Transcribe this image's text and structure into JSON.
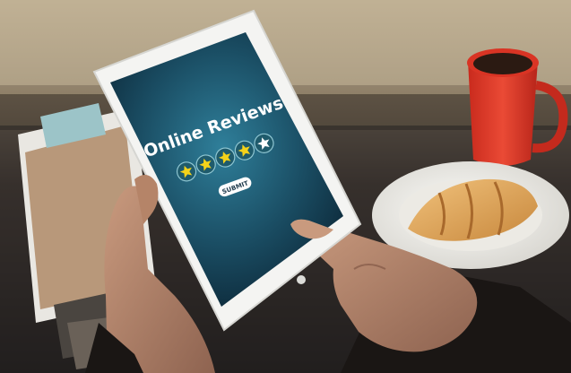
{
  "screen": {
    "title": "Online Reviews",
    "submit_label": "SUBMIT",
    "rating": {
      "filled": 4,
      "total": 5
    }
  },
  "colors": {
    "screen_glow": "#2f7f9a",
    "screen_dark": "#0c2636",
    "star_fill": "#f4d21a",
    "star_badge": "#1f5b6c",
    "mug": "#e2392a"
  },
  "icons": {
    "star": "star-icon"
  }
}
